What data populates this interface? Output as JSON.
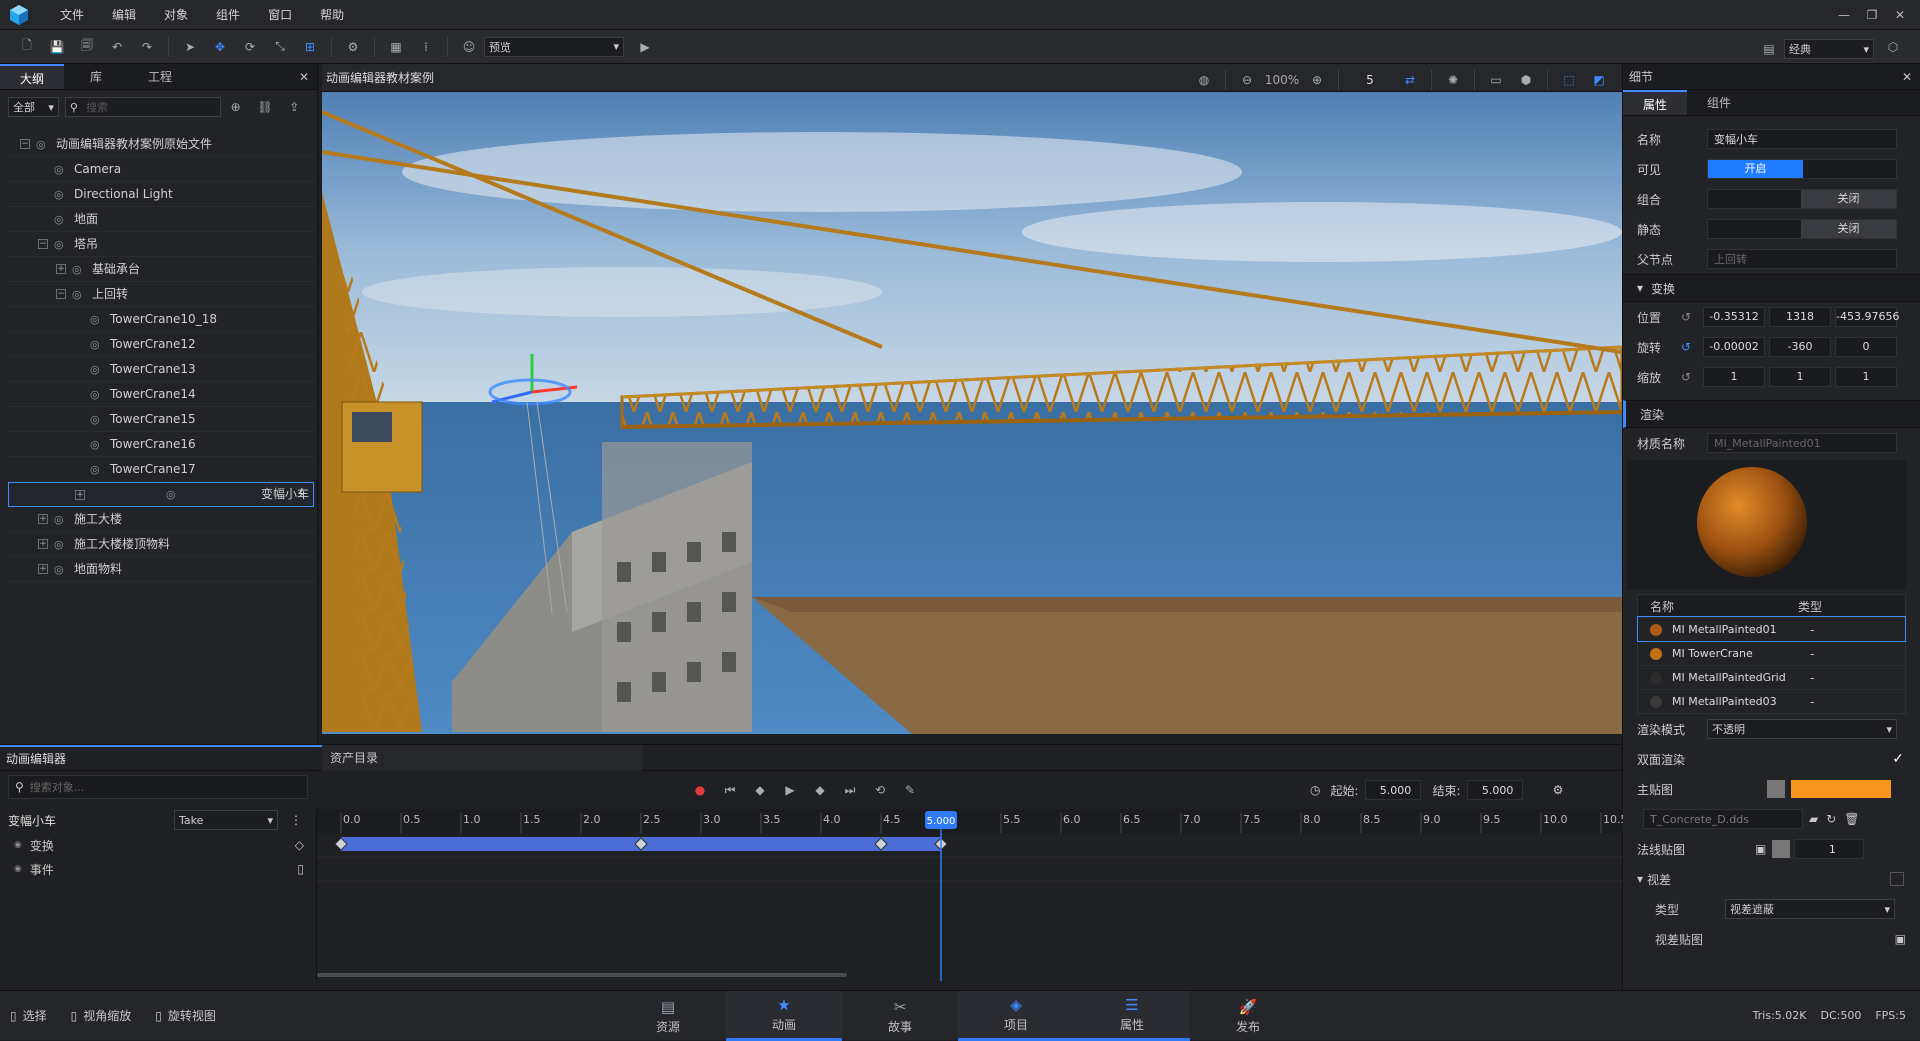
{
  "menu": {
    "items": [
      "文件",
      "编辑",
      "对象",
      "组件",
      "窗口",
      "帮助"
    ],
    "window_controls": [
      "—",
      "❐",
      "✕"
    ]
  },
  "toolbar": {
    "preview_label": "预览",
    "layout_label": "经典"
  },
  "left_panel": {
    "tabs": [
      "大纲",
      "库",
      "工程"
    ],
    "filter_label": "全部",
    "search_placeholder": "搜索",
    "tree": [
      {
        "label": "动画编辑器教材案例原始文件",
        "indent": 0,
        "expand": "−"
      },
      {
        "label": "Camera",
        "indent": 1,
        "expand": ""
      },
      {
        "label": "Directional Light",
        "indent": 1,
        "expand": ""
      },
      {
        "label": "地面",
        "indent": 1,
        "expand": ""
      },
      {
        "label": "塔吊",
        "indent": 1,
        "expand": "−"
      },
      {
        "label": "基础承台",
        "indent": 2,
        "expand": "+"
      },
      {
        "label": "上回转",
        "indent": 2,
        "expand": "−"
      },
      {
        "label": "TowerCrane10_18",
        "indent": 3,
        "expand": ""
      },
      {
        "label": "TowerCrane12",
        "indent": 3,
        "expand": ""
      },
      {
        "label": "TowerCrane13",
        "indent": 3,
        "expand": ""
      },
      {
        "label": "TowerCrane14",
        "indent": 3,
        "expand": ""
      },
      {
        "label": "TowerCrane15",
        "indent": 3,
        "expand": ""
      },
      {
        "label": "TowerCrane16",
        "indent": 3,
        "expand": ""
      },
      {
        "label": "TowerCrane17",
        "indent": 3,
        "expand": ""
      },
      {
        "label": "变幅小车",
        "indent": 3,
        "expand": "+",
        "selected": true
      },
      {
        "label": "施工大楼",
        "indent": 1,
        "expand": "+"
      },
      {
        "label": "施工大楼楼顶物料",
        "indent": 1,
        "expand": "+"
      },
      {
        "label": "地面物料",
        "indent": 1,
        "expand": "+"
      }
    ]
  },
  "viewport": {
    "title": "动画编辑器教材案例",
    "zoom": "100%",
    "speed": "5"
  },
  "details": {
    "title": "细节",
    "tabs": [
      "属性",
      "组件"
    ],
    "name_label": "名称",
    "name_value": "变幅小车",
    "visible_label": "可见",
    "visible_value": "开启",
    "group_label": "组合",
    "group_value": "关闭",
    "static_label": "静态",
    "static_value": "关闭",
    "parent_label": "父节点",
    "parent_value": "上回转",
    "transform_label": "变换",
    "position_label": "位置",
    "position": [
      "-0.35312",
      "1318",
      "-453.97656"
    ],
    "rotation_label": "旋转",
    "rotation": [
      "-0.00002",
      "-360",
      "0"
    ],
    "scale_label": "缩放",
    "scale": [
      "1",
      "1",
      "1"
    ],
    "render_label": "渲染",
    "material_name_label": "材质名称",
    "material_name_value": "MI_MetallPainted01",
    "mat_col_name": "名称",
    "mat_col_type": "类型",
    "materials": [
      {
        "name": "MI MetallPainted01",
        "type": "-",
        "color": "#b05a14"
      },
      {
        "name": "MI TowerCrane",
        "type": "-",
        "color": "#c07016"
      },
      {
        "name": "MI MetallPaintedGrid",
        "type": "-",
        "color": "#2c2c2c"
      },
      {
        "name": "MI MetallPainted03",
        "type": "-",
        "color": "#3a3a3a"
      }
    ],
    "render_mode_label": "渲染模式",
    "render_mode_value": "不透明",
    "double_sided_label": "双面渲染",
    "main_map_label": "主贴图",
    "main_map_color": "#f6961e",
    "main_map_file": "T_Concrete_D.dds",
    "normal_map_label": "法线贴图",
    "normal_map_value": "1",
    "parallax_label": "视差",
    "parallax_type_label": "类型",
    "parallax_type_value": "视差遮蔽",
    "parallax_map_label": "视差贴图"
  },
  "anim_editor": {
    "title": "动画编辑器",
    "search_placeholder": "搜索对象...",
    "assets_tab": "资产目录",
    "object_name": "变幅小车",
    "take": "Take",
    "tracks": [
      "变换",
      "事件"
    ],
    "start_label": "起始:",
    "start_value": "5.000",
    "end_label": "结束:",
    "end_value": "5.000",
    "ruler": [
      "0.0",
      "0.5",
      "1.0",
      "1.5",
      "2.0",
      "2.5",
      "3.0",
      "3.5",
      "4.0",
      "4.5",
      "5.000",
      "5.5",
      "6.0",
      "6.5",
      "7.0",
      "7.5",
      "8.0",
      "8.5",
      "9.0",
      "9.5",
      "10.0",
      "10.5"
    ],
    "keyframes": [
      0.0,
      2.5,
      4.5,
      5.0
    ],
    "playhead": 5.0
  },
  "bottom_bar": {
    "tools": [
      "选择",
      "视角缩放",
      "旋转视图"
    ],
    "tabs": [
      "资源",
      "动画",
      "故事",
      "项目",
      "属性",
      "发布"
    ],
    "active_tabs": [
      "动画",
      "项目"
    ],
    "stats": [
      "Tris:5.02K",
      "DC:500",
      "FPS:5"
    ]
  },
  "colors": {
    "accent": "#3d8bff",
    "record": "#e23b3b",
    "keyframe_bar": "#4b6ed6"
  }
}
